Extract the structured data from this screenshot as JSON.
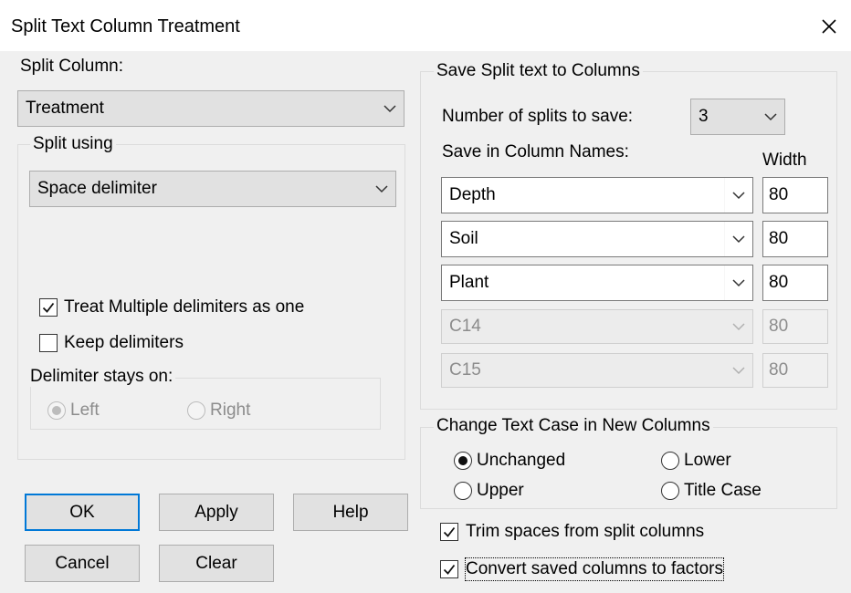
{
  "window": {
    "title": "Split Text Column Treatment"
  },
  "split_column": {
    "label": "Split Column:",
    "selected": "Treatment"
  },
  "split_using": {
    "legend": "Split using",
    "selected": "Space delimiter",
    "treat_multiple": {
      "label": "Treat Multiple delimiters as one",
      "checked": true
    },
    "keep_delimiters": {
      "label": "Keep delimiters",
      "checked": false
    },
    "delimiter_stays_on": {
      "legend": "Delimiter stays on:",
      "left": "Left",
      "right": "Right",
      "selected": "Left",
      "enabled": false
    }
  },
  "save_split": {
    "legend": "Save Split text to Columns",
    "num_splits_label": "Number of splits to save:",
    "num_splits": "3",
    "col_names_label": "Save in Column Names:",
    "width_label": "Width",
    "rows": [
      {
        "name": "Depth",
        "width": "80",
        "enabled": true
      },
      {
        "name": "Soil",
        "width": "80",
        "enabled": true
      },
      {
        "name": "Plant",
        "width": "80",
        "enabled": true
      },
      {
        "name": "C14",
        "width": "80",
        "enabled": false
      },
      {
        "name": "C15",
        "width": "80",
        "enabled": false
      }
    ]
  },
  "text_case": {
    "legend": "Change Text Case in New Columns",
    "unchanged": "Unchanged",
    "lower": "Lower",
    "upper": "Upper",
    "title_case": "Title Case",
    "selected": "Unchanged"
  },
  "trim_spaces": {
    "label": "Trim spaces from split columns",
    "checked": true
  },
  "convert_factors": {
    "label": "Convert saved columns to factors",
    "checked": true
  },
  "buttons": {
    "ok": "OK",
    "apply": "Apply",
    "help": "Help",
    "cancel": "Cancel",
    "clear": "Clear"
  },
  "icons": {
    "close": "close-icon",
    "dropdown": "chevron-down-icon",
    "check": "checkmark-icon"
  }
}
